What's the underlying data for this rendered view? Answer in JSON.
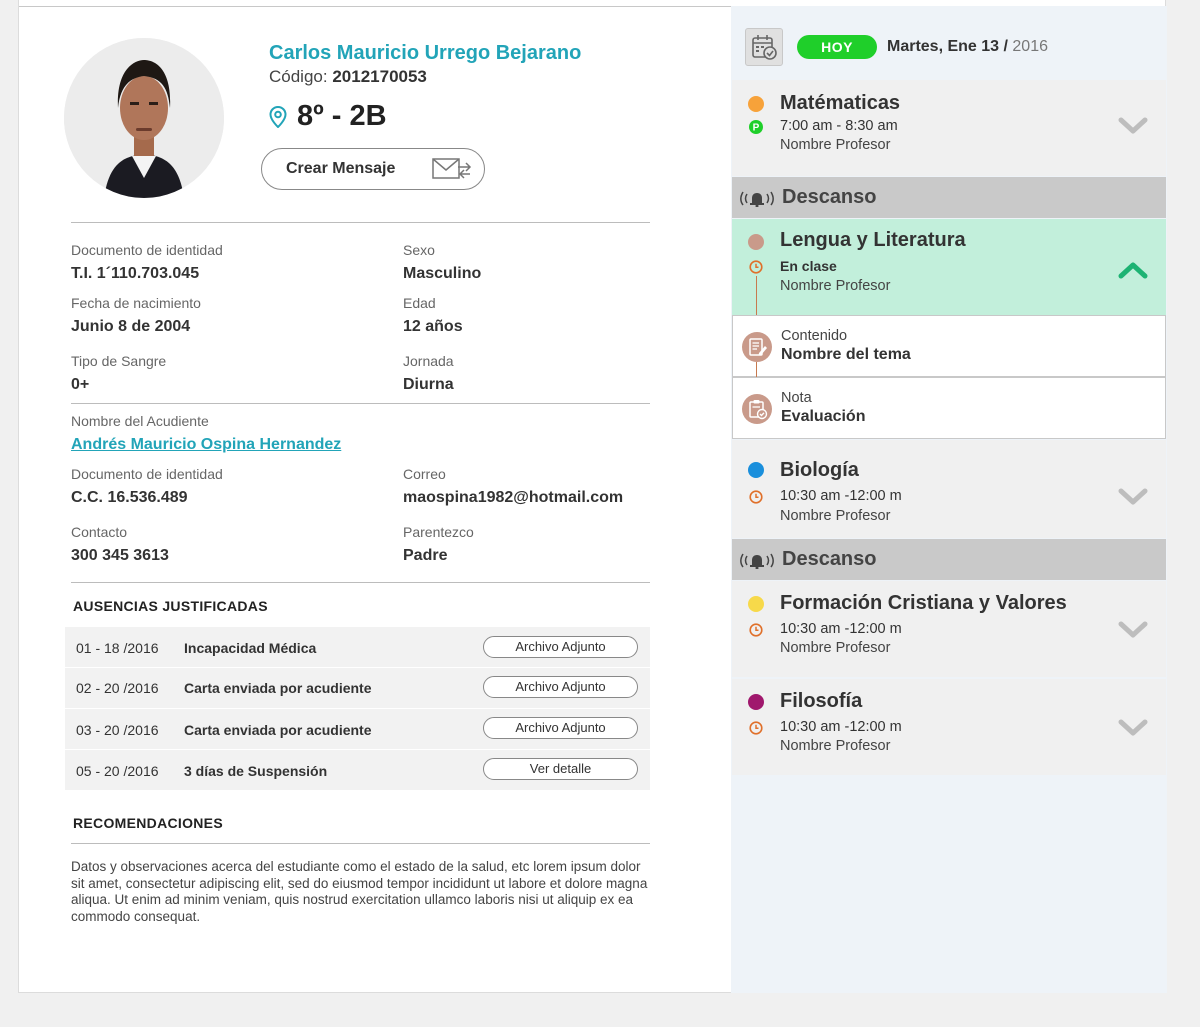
{
  "student": {
    "name": "Carlos Mauricio Urrego Bejarano",
    "code_label": "Código:",
    "code": "2012170053",
    "grade": "8º - 2B",
    "message_button": "Crear Mensaje"
  },
  "details": {
    "doc_label": "Documento de identidad",
    "doc_value": "T.I. 1´110.703.045",
    "sex_label": "Sexo",
    "sex_value": "Masculino",
    "birth_label": "Fecha de nacimiento",
    "birth_value": "Junio 8 de 2004",
    "age_label": "Edad",
    "age_value": "12 años",
    "blood_label": "Tipo de Sangre",
    "blood_value": "0+",
    "shift_label": "Jornada",
    "shift_value": "Diurna"
  },
  "guardian": {
    "name_label": "Nombre del Acudiente",
    "name_value": "Andrés Mauricio Ospina Hernandez",
    "doc_label": "Documento de identidad",
    "doc_value": "C.C. 16.536.489",
    "email_label": "Correo",
    "email_value": "maospina1982@hotmail.com",
    "contact_label": "Contacto",
    "contact_value": "300 345 3613",
    "relation_label": "Parentezco",
    "relation_value": "Padre"
  },
  "absences": {
    "title": "AUSENCIAS JUSTIFICADAS",
    "rows": [
      {
        "date": "01 - 18 /2016",
        "reason": "Incapacidad Médica",
        "button": "Archivo Adjunto"
      },
      {
        "date": "02 - 20 /2016",
        "reason": "Carta enviada por acudiente",
        "button": "Archivo Adjunto"
      },
      {
        "date": "03 - 20 /2016",
        "reason": "Carta enviada por acudiente",
        "button": "Archivo Adjunto"
      },
      {
        "date": "05 - 20 /2016",
        "reason": "3 días de Suspensión",
        "button": "Ver detalle"
      }
    ]
  },
  "recommendations": {
    "title": "RECOMENDACIONES",
    "text": "Datos y observaciones acerca del estudiante como el estado de la salud, etc lorem ipsum dolor sit amet, consectetur adipiscing elit, sed do eiusmod tempor incididunt ut labore et dolore magna aliqua. Ut enim ad minim veniam, quis nostrud exercitation ullamco laboris nisi ut aliquip ex ea commodo consequat."
  },
  "schedule": {
    "today_badge": "HOY",
    "day": "Martes, Ene 13 /",
    "year": "2016",
    "break_label": "Descanso",
    "classes": [
      {
        "title": "Matématicas",
        "time": "7:00 am - 8:30 am",
        "teacher": "Nombre Profesor",
        "color": "#f7a23a"
      },
      {
        "title": "Lengua y Literatura",
        "status": "En clase",
        "teacher": "Nombre Profesor",
        "color": "#c99a8a"
      },
      {
        "title": "Biología",
        "time": "10:30 am -12:00 m",
        "teacher": "Nombre Profesor",
        "color": "#1a8fdc"
      },
      {
        "title": "Formación Cristiana y Valores",
        "time": "10:30 am -12:00 m",
        "teacher": "Nombre Profesor",
        "color": "#f7d94a"
      },
      {
        "title": "Filosofía",
        "time": "10:30 am -12:00 m",
        "teacher": "Nombre Profesor",
        "color": "#a0186d"
      }
    ],
    "detail": {
      "content_label": "Contenido",
      "content_value": "Nombre del tema",
      "grade_label": "Nota",
      "grade_value": "Evaluación"
    },
    "colors": {
      "green_accent": "#1fcf2a",
      "active_bg": "#c2efdb",
      "link": "#22a4b8",
      "clock": "#e0702a"
    }
  }
}
